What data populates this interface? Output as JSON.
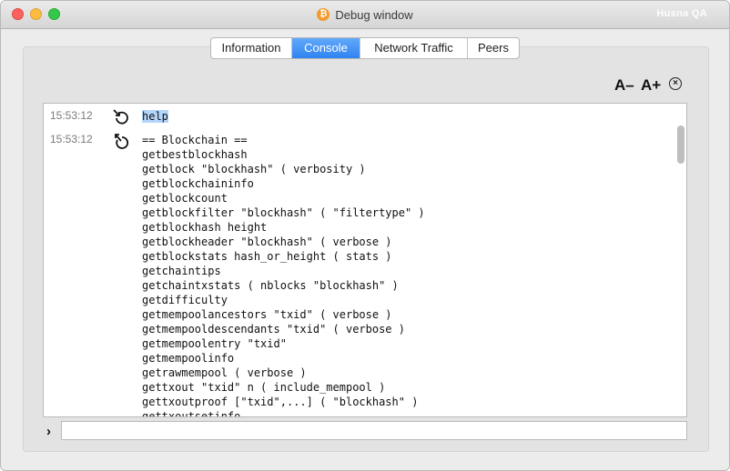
{
  "window": {
    "title": "Debug window",
    "user_label": "Husna QA",
    "title_icon": "bitcoin-icon"
  },
  "tabs": [
    {
      "label": "Information",
      "active": false
    },
    {
      "label": "Console",
      "active": true
    },
    {
      "label": "Network Traffic",
      "active": false
    },
    {
      "label": "Peers",
      "active": false
    }
  ],
  "toolbar": {
    "font_smaller_label": "A–",
    "font_larger_label": "A+",
    "clear_icon": "clear-console-icon"
  },
  "console": {
    "entries": [
      {
        "timestamp": "15:53:12",
        "direction": "input",
        "text": "help"
      },
      {
        "timestamp": "15:53:12",
        "direction": "output",
        "lines": [
          "== Blockchain ==",
          "getbestblockhash",
          "getblock \"blockhash\" ( verbosity )",
          "getblockchaininfo",
          "getblockcount",
          "getblockfilter \"blockhash\" ( \"filtertype\" )",
          "getblockhash height",
          "getblockheader \"blockhash\" ( verbose )",
          "getblockstats hash_or_height ( stats )",
          "getchaintips",
          "getchaintxstats ( nblocks \"blockhash\" )",
          "getdifficulty",
          "getmempoolancestors \"txid\" ( verbose )",
          "getmempooldescendants \"txid\" ( verbose )",
          "getmempoolentry \"txid\"",
          "getmempoolinfo",
          "getrawmempool ( verbose )",
          "gettxout \"txid\" n ( include_mempool )",
          "gettxoutproof [\"txid\",...] ( \"blockhash\" )",
          "gettxoutsetinfo"
        ]
      }
    ]
  },
  "prompt": {
    "icon": "prompt-chevron-icon",
    "value": "",
    "placeholder": ""
  }
}
